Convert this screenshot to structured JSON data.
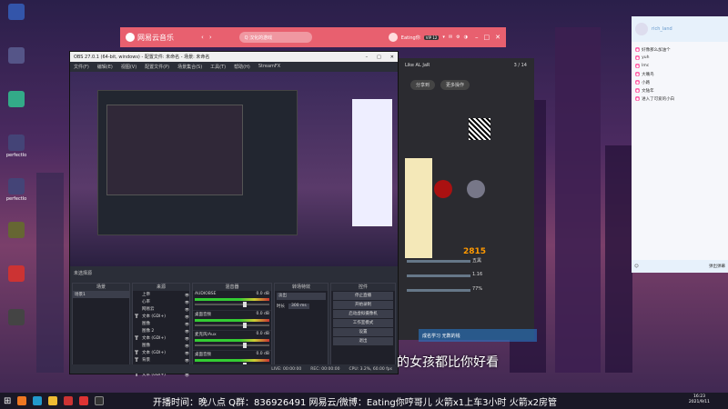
{
  "desktop": {
    "icons": [
      {
        "label": "",
        "color": "#35a"
      },
      {
        "label": "",
        "color": "#558"
      },
      {
        "label": "",
        "color": "#3a8"
      },
      {
        "label": "perfectlo",
        "color": "#447"
      },
      {
        "label": "perfectlo",
        "color": "#447"
      },
      {
        "label": "",
        "color": "#663"
      },
      {
        "label": "",
        "color": "#c33"
      },
      {
        "label": "",
        "color": "#444"
      }
    ]
  },
  "netease": {
    "app_name": "网易云音乐",
    "search_placeholder": "Q 汉化的游戏",
    "user_name": "Eating你",
    "vip_label": "VIP 12",
    "right_header": "Like AL JaR",
    "page_indicator": "3 / 14",
    "btn_left": "分享到",
    "btn_right": "更多操作",
    "score": "2815",
    "stat1": "五黑",
    "stat2": "1.16",
    "stat3": "77%"
  },
  "obs": {
    "title": "OBS 27.0.1 (64-bit, windows) - 配置文件: 未命名 - 场景: 未命名",
    "menus": [
      "文件(F)",
      "编辑(E)",
      "视图(V)",
      "配置文件(P)",
      "场景集合(S)",
      "工具(T)",
      "帮助(H)",
      "StreamFX"
    ],
    "no_source": "未选择源",
    "docks": {
      "scenes": "场景",
      "sources": "来源",
      "mixer": "混音器",
      "transitions": "转场特效",
      "controls": "控件"
    },
    "scene_name": "场景1",
    "sources": [
      {
        "type": "",
        "name": "上帝"
      },
      {
        "type": "",
        "name": "心率"
      },
      {
        "type": "",
        "name": "网易云"
      },
      {
        "type": "T",
        "name": "文本 (GDI+)"
      },
      {
        "type": "",
        "name": "图像"
      },
      {
        "type": "",
        "name": "图像 2"
      },
      {
        "type": "T",
        "name": "文本 (GDI+)"
      },
      {
        "type": "",
        "name": "图像"
      },
      {
        "type": "T",
        "name": "文本 (GDI+)"
      },
      {
        "type": "T",
        "name": "背景"
      },
      {
        "type": "T",
        "name": "文本 (GDI+)"
      },
      {
        "type": "T",
        "name": "文本 (GDI+)"
      }
    ],
    "mixer": [
      {
        "name": "AUDIOBSE",
        "db": "0.0 dB"
      },
      {
        "name": "桌面音频",
        "db": "0.0 dB"
      },
      {
        "name": "麦克风/Aux",
        "db": "0.0 dB"
      },
      {
        "name": "桌面音频",
        "db": "0.0 dB"
      }
    ],
    "transition_type": "淡出",
    "duration_label": "时长",
    "duration_value": "300 ms",
    "controls": [
      "停止直播",
      "开始录制",
      "启动虚拟摄像机",
      "工作室模式",
      "设置",
      "退出"
    ],
    "status": [
      "LIVE: 00:00:00",
      "REC: 00:00:00",
      "CPU: 3.2%, 60.00 fps"
    ]
  },
  "chat": {
    "title": "rich_land",
    "lines": [
      "好像那么加油个",
      "yuh",
      "lmc",
      "大嘴鸟",
      "小路",
      "文陆年",
      "进入了可爱的小白"
    ],
    "bottom_text": "弹出弹幕"
  },
  "lyric": "的女孩都比你好看",
  "lyric_highlight": "成名学习 无数的钱",
  "taskbar": {
    "marquee": "开播时间：晚八点    Q群：836926491    网易云/微博：Eating你哼哥儿    火箭x1上车3小时    火箭x2房管",
    "time": "16:23",
    "date": "2021/9/11"
  }
}
